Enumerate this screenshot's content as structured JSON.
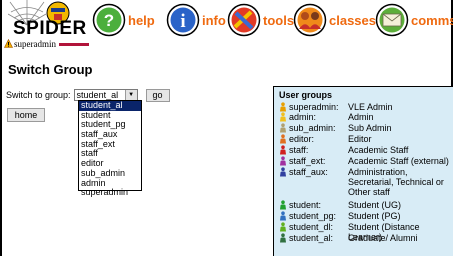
{
  "app": {
    "logo_text": "SPIDER",
    "nav": [
      {
        "label": "help",
        "icon": "question-icon"
      },
      {
        "label": "info",
        "icon": "info-icon"
      },
      {
        "label": "tools",
        "icon": "tools-icon"
      },
      {
        "label": "classes",
        "icon": "classes-icon"
      },
      {
        "label": "comms",
        "icon": "comms-icon"
      }
    ],
    "nav_color": "#ef6a10"
  },
  "user": {
    "name": "superadmin",
    "bar_color": "#b1143a"
  },
  "page": {
    "title": "Switch Group"
  },
  "switch": {
    "label": "Switch to group:",
    "selected": "student_al",
    "go_label": "go",
    "home_label": "home",
    "options": [
      "student_al",
      "student",
      "student_pg",
      "staff_aux",
      "staff_ext",
      "staff",
      "editor",
      "sub_admin",
      "admin",
      "superadmin"
    ]
  },
  "groups": {
    "title": "User groups",
    "items": [
      {
        "name": "superadmin:",
        "desc": "VLE Admin",
        "color": "#e8a000"
      },
      {
        "name": "admin:",
        "desc": "Admin",
        "color": "#f0c020"
      },
      {
        "name": "sub_admin:",
        "desc": "Sub Admin",
        "color": "#b0a070"
      },
      {
        "name": "editor:",
        "desc": "Editor",
        "color": "#e07020"
      },
      {
        "name": "staff:",
        "desc": "Academic Staff",
        "color": "#d02020"
      },
      {
        "name": "staff_ext:",
        "desc": "Academic Staff (external)",
        "color": "#a030a0"
      },
      {
        "name": "staff_aux:",
        "desc": "Administration, Secretarial, Technical or Other staff",
        "color": "#3040a0"
      },
      {
        "name": "student:",
        "desc": "Student (UG)",
        "color": "#20a030"
      },
      {
        "name": "student_pg:",
        "desc": "Student (PG)",
        "color": "#3070c0"
      },
      {
        "name": "student_dl:",
        "desc": "Student (Distance Learner)",
        "color": "#60b020"
      },
      {
        "name": "student_al:",
        "desc": "Graduate/ Alumni",
        "color": "#307040"
      }
    ]
  }
}
